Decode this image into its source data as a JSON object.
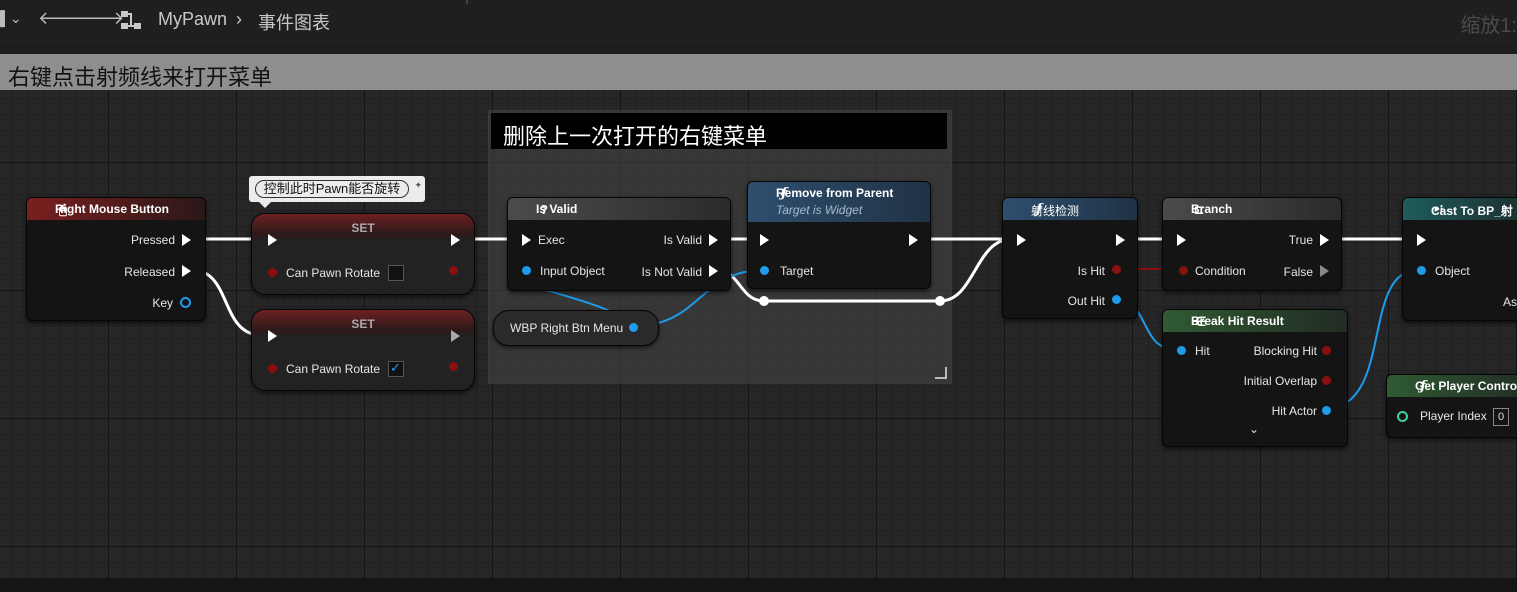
{
  "toolbar": {
    "graph_owner": "MyPawn",
    "graph_name": "事件图表",
    "zoom_label": "缩放1:"
  },
  "comments": {
    "main_title": "右键点击射频线来打开菜单",
    "inner_title": "删除上一次打开的右键菜单"
  },
  "nodes": {
    "rmb": {
      "title": "Right Mouse Button",
      "pressed": "Pressed",
      "released": "Released",
      "key": "Key"
    },
    "set1": {
      "title": "SET",
      "var": "Can Pawn Rotate",
      "value": false
    },
    "set2": {
      "title": "SET",
      "var": "Can Pawn Rotate",
      "value": true
    },
    "set_tooltip": "控制此时Pawn能否旋转",
    "is_valid": {
      "title": "Is Valid",
      "exec": "Exec",
      "input": "Input Object",
      "is_valid": "Is Valid",
      "is_not_valid": "Is Not Valid"
    },
    "wbp_var": "WBP Right Btn Menu",
    "remove": {
      "title": "Remove from Parent",
      "subtitle": "Target is Widget",
      "target": "Target"
    },
    "trace": {
      "title": "射线检测",
      "is_hit": "Is Hit",
      "out_hit": "Out Hit"
    },
    "branch": {
      "title": "Branch",
      "condition": "Condition",
      "true": "True",
      "false": "False"
    },
    "break_hit": {
      "title": "Break Hit Result",
      "hit": "Hit",
      "blocking_hit": "Blocking Hit",
      "initial_overlap": "Initial Overlap",
      "hit_actor": "Hit Actor"
    },
    "cast": {
      "title": "Cast To BP_射",
      "object": "Object",
      "as": "As"
    },
    "get_pc": {
      "title": "Get Player Contro",
      "player_index": "Player Index",
      "index_value": "0"
    }
  },
  "colors": {
    "exec_wire": "#ffffff",
    "object_wire": "#1e9bea",
    "bool_wire": "#8a1010",
    "event_header": "#7a1f1f",
    "function_header": "#2e4e6e",
    "pure_header": "#2f5a33",
    "cast_header": "#1f5c5c"
  },
  "icons": {
    "back": "arrow-left-icon",
    "forward": "arrow-right-icon",
    "graph": "node-graph-icon",
    "mouse": "mouse-icon",
    "function": "function-icon",
    "question": "question-icon",
    "branch": "branch-icon",
    "break": "break-struct-icon",
    "cast": "cast-icon"
  }
}
